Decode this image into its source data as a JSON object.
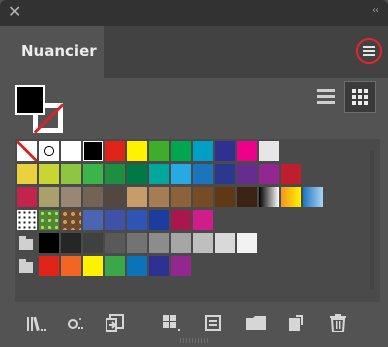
{
  "window": {
    "close_glyph": "✕",
    "collapse_glyph": "‹‹"
  },
  "panel": {
    "title": "Nuancier"
  },
  "icons": {
    "menu": "hamburger-menu-icon",
    "list_view": "list-view-icon",
    "grid_view": "grid-view-icon",
    "library": "library-icon",
    "show_kinds": "swatch-kinds-icon",
    "place": "place-icon",
    "swatch_options": "swatch-options-icon",
    "new_group": "new-color-group-icon",
    "new_swatch": "new-swatch-icon",
    "delete": "trash-icon"
  },
  "swatch_rows": [
    {
      "kind": "basic",
      "colors": [
        "none",
        "registration",
        "#ffffff",
        "#000000",
        "#e2231a",
        "#fff200",
        "#3dae2b",
        "#00a650",
        "#00a0c6",
        "#2e3192",
        "#ec008c",
        "#e6e6e6"
      ]
    },
    {
      "kind": "colors",
      "colors": [
        "#e8d33f",
        "#c9d533",
        "#8dc63f",
        "#39b54a",
        "#1e8f3f",
        "#007944",
        "#00a79d",
        "#27aae1",
        "#1c75bc",
        "#2b388f",
        "#662d91",
        "#92278f",
        "#be1e2d"
      ]
    },
    {
      "kind": "colors",
      "colors": [
        "#c1254c",
        "#a9a06b",
        "#998675",
        "#736357",
        "#534741",
        "#c69c6d",
        "#a67c52",
        "#8c6239",
        "#754c24",
        "#603813",
        "#3c2415",
        "gradient-bw",
        "gradient-orange",
        "gradient-blue"
      ]
    },
    {
      "kind": "patterns",
      "colors": [
        "pattern-dots",
        "pattern-leaves",
        "pattern-swirl",
        "#4a66b3",
        "#3f52a8",
        "#2e55b5",
        "#1c3ca0",
        "#a8184e",
        "#cf1d8b"
      ]
    },
    {
      "kind": "grays",
      "colors": [
        "#000000",
        "#262626",
        "#404040",
        "#595959",
        "#737373",
        "#8c8c8c",
        "#a6a6a6",
        "#bfbfbf",
        "#d9d9d9",
        "#f2f2f2"
      ]
    },
    {
      "kind": "brights",
      "colors": [
        "#e2231a",
        "#f26522",
        "#fff200",
        "#3aa748",
        "#0d73b9",
        "#2e3192",
        "#92278f"
      ]
    }
  ]
}
